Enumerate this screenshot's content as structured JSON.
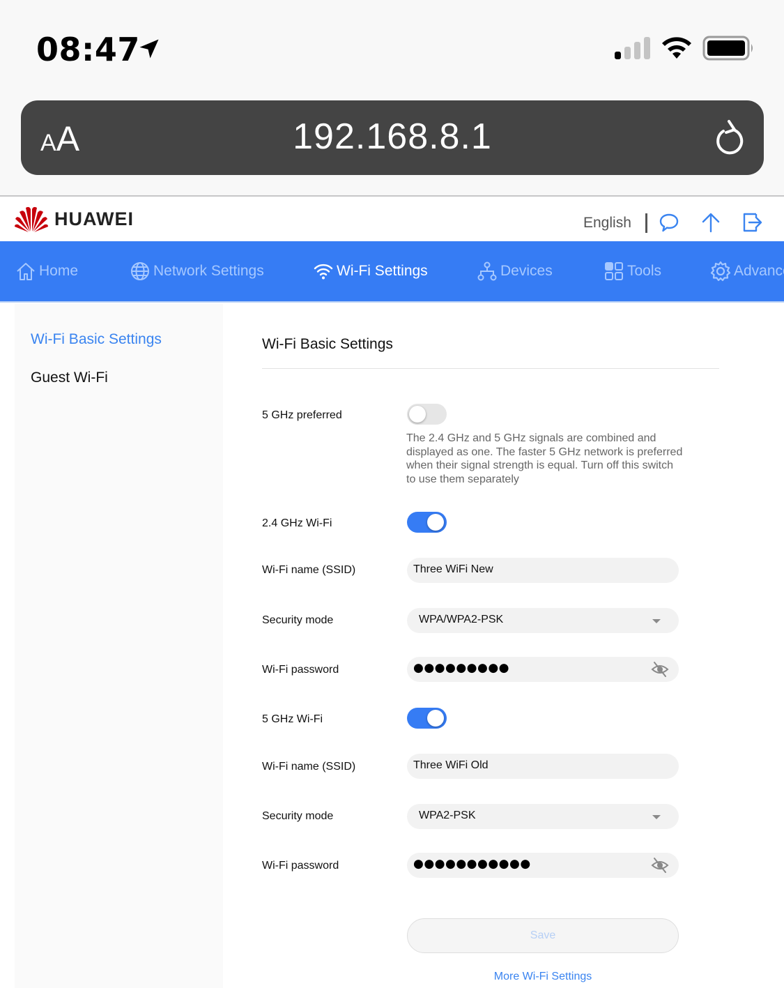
{
  "status_bar": {
    "time": "08:47",
    "icons": [
      "location-arrow-icon",
      "cellular-signal-icon",
      "wifi-icon",
      "battery-icon"
    ],
    "signal_bars_active": 1,
    "signal_bars_total": 4
  },
  "browser": {
    "text_size_small": "A",
    "text_size_big": "A",
    "url": "192.168.8.1",
    "reload_icon": "reload-icon"
  },
  "header": {
    "brand": "HUAWEI",
    "language": "English",
    "icons": [
      "message-icon",
      "update-arrow-icon",
      "logout-icon"
    ],
    "accent_color": "#367cf4"
  },
  "nav": {
    "items": [
      {
        "label": "Home",
        "icon": "home-icon",
        "active": false
      },
      {
        "label": "Network Settings",
        "icon": "globe-icon",
        "active": false
      },
      {
        "label": "Wi-Fi Settings",
        "icon": "wifi-icon",
        "active": true
      },
      {
        "label": "Devices",
        "icon": "devices-topology-icon",
        "active": false
      },
      {
        "label": "Tools",
        "icon": "grid-icon",
        "active": false
      },
      {
        "label": "Advanced",
        "icon": "gear-icon",
        "active": false
      }
    ]
  },
  "sidebar": {
    "items": [
      {
        "label": "Wi-Fi Basic Settings",
        "active": true
      },
      {
        "label": "Guest Wi-Fi",
        "active": false
      }
    ]
  },
  "main": {
    "title": "Wi-Fi Basic Settings",
    "five_ghz_preferred": {
      "label": "5 GHz preferred",
      "enabled": false,
      "hint": "The 2.4 GHz and 5 GHz signals are combined and displayed as one. The faster 5 GHz network is preferred when their signal strength is equal. Turn off this switch to use them separately"
    },
    "band_24": {
      "toggle_label": "2.4 GHz Wi-Fi",
      "enabled": true,
      "ssid_label": "Wi-Fi name (SSID)",
      "ssid": "Three WiFi New",
      "security_label": "Security mode",
      "security": "WPA/WPA2-PSK",
      "password_label": "Wi-Fi password",
      "password_masked": "●●●●●●●●●"
    },
    "band_5": {
      "toggle_label": "5 GHz Wi-Fi",
      "enabled": true,
      "ssid_label": "Wi-Fi name (SSID)",
      "ssid": "Three WiFi Old",
      "security_label": "Security mode",
      "security": "WPA2-PSK",
      "password_label": "Wi-Fi password",
      "password_masked": "●●●●●●●●●●●"
    },
    "save_label": "Save",
    "more_link": "More Wi-Fi Settings"
  }
}
